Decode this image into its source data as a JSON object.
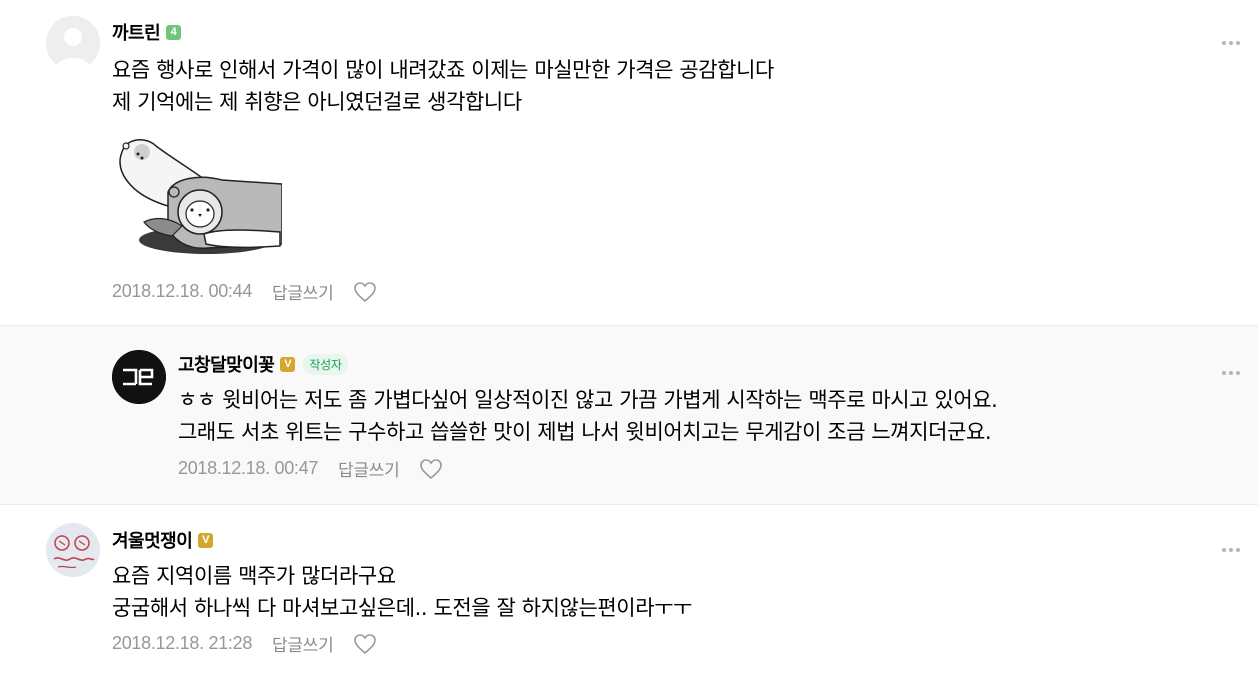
{
  "comments": [
    {
      "nickname": "까트린",
      "badge": "4",
      "badge_color": "#6fc57a",
      "lines": [
        "요즘 행사로 인해서 가격이 많이 내려갔죠 이제는 마실만한 가격은 공감합니다",
        "제 기억에는 제 취향은 아니였던걸로 생각합니다"
      ],
      "date": "2018.12.18. 00:44",
      "reply_label": "답글쓰기",
      "sticker_icon": "sleeping-bear-sticker"
    },
    {
      "nickname": "고창달맞이꽃",
      "badge": "V",
      "badge_color": "#d1a72e",
      "author_tag": "작성자",
      "avatar_text": "ㄱㄷ",
      "lines": [
        "ㅎㅎ 윗비어는 저도 좀 가볍다싶어 일상적이진 않고 가끔 가볍게 시작하는 맥주로 마시고 있어요.",
        "그래도 서초 위트는 구수하고 씁쓸한 맛이 제법 나서 윗비어치고는 무게감이 조금 느껴지더군요."
      ],
      "date": "2018.12.18. 00:47",
      "reply_label": "답글쓰기"
    },
    {
      "nickname": "겨울멋쟁이",
      "badge": "V",
      "badge_color": "#d1a72e",
      "lines": [
        "요즘 지역이름 맥주가 많더라구요",
        "궁굼해서 하나씩 다 마셔보고싶은데.. 도전을 잘 하지않는편이라ㅜㅜ"
      ],
      "date": "2018.12.18. 21:28",
      "reply_label": "답글쓰기"
    }
  ],
  "colors": {
    "reply_bg": "#f9f9f9",
    "meta": "#979797",
    "author_tag": "#16a05a"
  }
}
